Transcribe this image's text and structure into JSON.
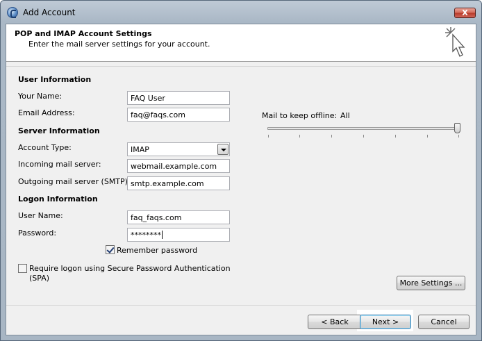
{
  "window": {
    "title": "Add Account",
    "close_label": "X"
  },
  "header": {
    "title": "POP and IMAP Account Settings",
    "subtitle": "Enter the mail server settings for your account."
  },
  "user_info": {
    "heading": "User Information",
    "name_label": "Your Name:",
    "name_value": "FAQ User",
    "email_label": "Email Address:",
    "email_value": "faq@faqs.com"
  },
  "server_info": {
    "heading": "Server Information",
    "account_type_label": "Account Type:",
    "account_type_value": "IMAP",
    "incoming_label": "Incoming mail server:",
    "incoming_value": "webmail.example.com",
    "outgoing_label": "Outgoing mail server (SMTP):",
    "outgoing_value": "smtp.example.com"
  },
  "logon_info": {
    "heading": "Logon Information",
    "username_label": "User Name:",
    "username_value": "faq_faqs.com",
    "password_label": "Password:",
    "password_value": "********",
    "remember_label": "Remember password",
    "remember_checked": true,
    "spa_label_line1": "Require logon using Secure Password Authentication",
    "spa_label_line2": "(SPA)",
    "spa_checked": false
  },
  "offline": {
    "label": "Mail to keep offline:",
    "value": "All",
    "slider_position": 1.0
  },
  "buttons": {
    "more_settings": "More Settings ...",
    "back": "< Back",
    "next": "Next >",
    "cancel": "Cancel"
  },
  "colors": {
    "title_bar": "#aab8c6",
    "dialog_background": "#f0f0f0",
    "close_button": "#c8533f",
    "default_button_border": "#3c7fb1"
  }
}
